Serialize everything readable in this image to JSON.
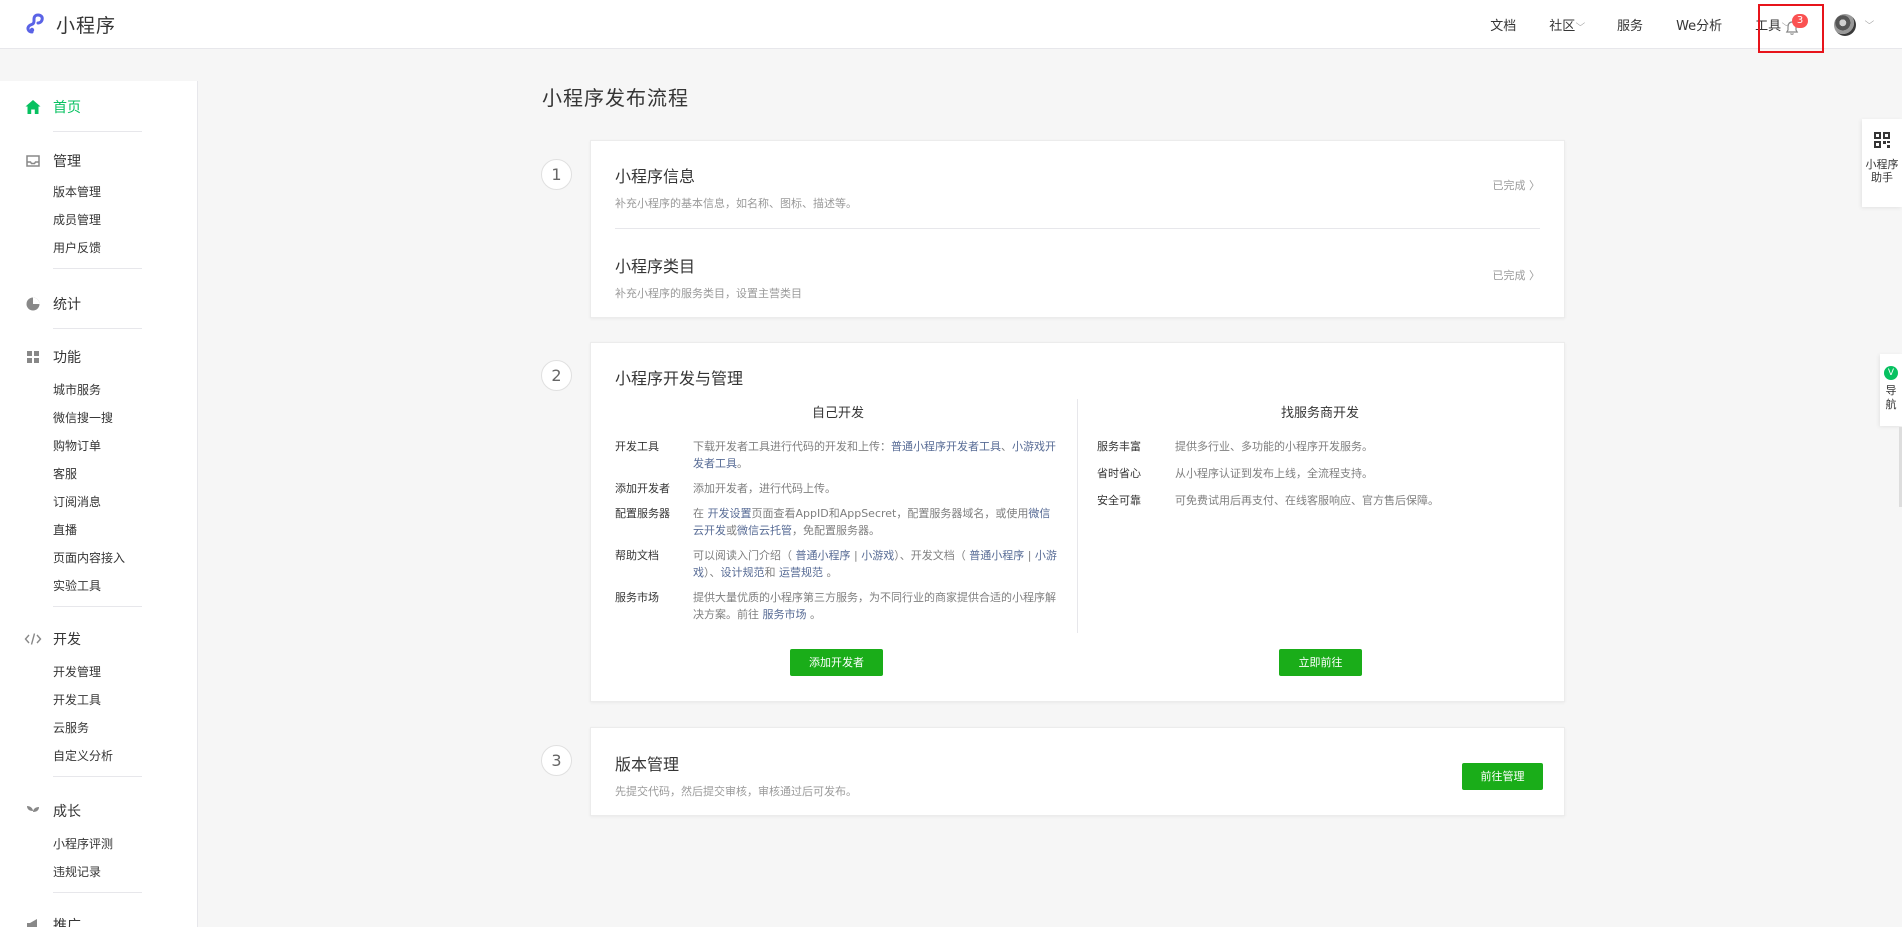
{
  "app": {
    "logo_text": "小程序",
    "brand_color": "#07c160",
    "button_color": "#1aad19",
    "link_color": "#576b95"
  },
  "topnav": {
    "items": [
      {
        "label": "文档",
        "dropdown": false
      },
      {
        "label": "社区",
        "dropdown": true
      },
      {
        "label": "服务",
        "dropdown": false
      },
      {
        "label": "We分析",
        "dropdown": false
      },
      {
        "label": "工具",
        "dropdown": true
      }
    ],
    "notification_count": "3",
    "chevron": "⌵"
  },
  "sidebar": {
    "groups": [
      {
        "label": "首页",
        "icon": "home-icon",
        "active": true,
        "items": []
      },
      {
        "label": "管理",
        "icon": "inbox-icon",
        "items": [
          "版本管理",
          "成员管理",
          "用户反馈"
        ]
      },
      {
        "label": "统计",
        "icon": "pie-chart-icon",
        "items": []
      },
      {
        "label": "功能",
        "icon": "grid-icon",
        "items": [
          "城市服务",
          "微信搜一搜",
          "购物订单",
          "客服",
          "订阅消息",
          "直播",
          "页面内容接入",
          "实验工具"
        ]
      },
      {
        "label": "开发",
        "icon": "code-icon",
        "items": [
          "开发管理",
          "开发工具",
          "云服务",
          "自定义分析"
        ]
      },
      {
        "label": "成长",
        "icon": "sprout-icon",
        "items": [
          "小程序评测",
          "违规记录"
        ]
      },
      {
        "label": "推广",
        "icon": "megaphone-icon",
        "items": []
      }
    ]
  },
  "main": {
    "title": "小程序发布流程",
    "step1": {
      "num": "1",
      "rows": [
        {
          "title": "小程序信息",
          "desc": "补充小程序的基本信息，如名称、图标、描述等。",
          "status": "已完成 〉"
        },
        {
          "title": "小程序类目",
          "desc": "补充小程序的服务类目，设置主营类目",
          "status": "已完成 〉"
        }
      ]
    },
    "step2": {
      "num": "2",
      "title": "小程序开发与管理",
      "self_dev": {
        "heading": "自己开发",
        "rows": {
          "tools": {
            "key": "开发工具",
            "text1": "下载开发者工具进行代码的开发和上传：",
            "link1": "普通小程序开发者工具",
            "sep": "、",
            "link2": "小游戏开发者工具",
            "tail": "。"
          },
          "add_dev": {
            "key": "添加开发者",
            "text": "添加开发者，进行代码上传。"
          },
          "server": {
            "key": "配置服务器",
            "t1": "在 ",
            "link1": "开发设置",
            "t2": "页面查看AppID和AppSecret，配置服务器域名，或使用",
            "link2": "微信云开发",
            "t3": "或",
            "link3": "微信云托管",
            "t4": "，免配置服务器。"
          },
          "docs": {
            "key": "帮助文档",
            "t1": "可以阅读入门介绍（ ",
            "link1": "普通小程序",
            "bar1": " | ",
            "link2": "小游戏",
            "t2": "）、开发文档（ ",
            "link3": "普通小程序",
            "bar2": " | ",
            "link4": "小游戏",
            "t3": "）、",
            "link5": "设计规范",
            "t4": "和 ",
            "link6": "运营规范",
            "t5": " 。"
          },
          "market": {
            "key": "服务市场",
            "t1": "提供大量优质的小程序第三方服务，为不同行业的商家提供合适的小程序解决方案。前往 ",
            "link1": "服务市场",
            "t2": " 。"
          }
        },
        "button": "添加开发者"
      },
      "provider_dev": {
        "heading": "找服务商开发",
        "rows": [
          {
            "key": "服务丰富",
            "text": "提供多行业、多功能的小程序开发服务。"
          },
          {
            "key": "省时省心",
            "text": "从小程序认证到发布上线，全流程支持。"
          },
          {
            "key": "安全可靠",
            "text": "可免费试用后再支付、在线客服响应、官方售后保障。"
          }
        ],
        "button": "立即前往"
      }
    },
    "step3": {
      "num": "3",
      "title": "版本管理",
      "desc": "先提交代码，然后提交审核，审核通过后可发布。",
      "button": "前往管理"
    }
  },
  "floating": {
    "assistant_label_1": "小程序",
    "assistant_label_2": "助手",
    "guide_badge": "V",
    "guide_label_1": "导",
    "guide_label_2": "航"
  }
}
